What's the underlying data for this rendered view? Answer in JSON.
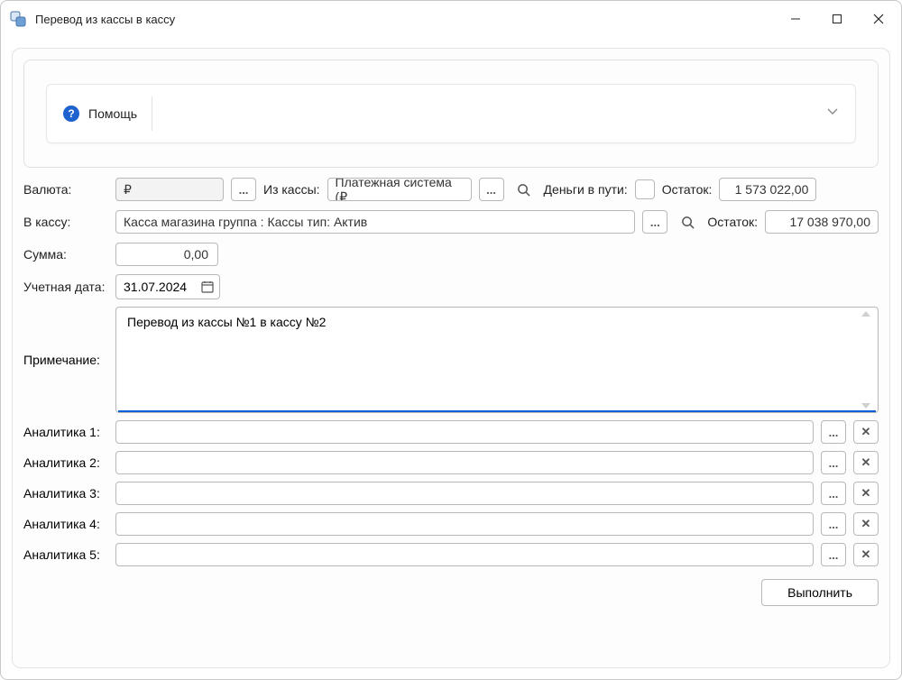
{
  "window": {
    "title": "Перевод из кассы в кассу"
  },
  "help": {
    "label": "Помощь"
  },
  "labels": {
    "currency": "Валюта:",
    "from_cash": "Из кассы:",
    "in_transit": "Деньги в пути:",
    "balance": "Остаток:",
    "to_cash": "В кассу:",
    "balance2": "Остаток:",
    "sum": "Сумма:",
    "accounting_date": "Учетная дата:",
    "note": "Примечание:",
    "analytics1": "Аналитика 1:",
    "analytics2": "Аналитика 2:",
    "analytics3": "Аналитика 3:",
    "analytics4": "Аналитика 4:",
    "analytics5": "Аналитика 5:"
  },
  "values": {
    "currency": "₽",
    "from_cash": "Платежная система (₽",
    "balance_from": "1 573 022,00",
    "to_cash": "Касса магазина  группа : Кассы тип: Актив",
    "balance_to": "17 038 970,00",
    "sum": "0,00",
    "accounting_date": "31.07.2024",
    "note": "Перевод из кассы №1 в кассу №2",
    "an1": "",
    "an2": "",
    "an3": "",
    "an4": "",
    "an5": ""
  },
  "buttons": {
    "ellipsis": "...",
    "clear": "✕",
    "execute": "Выполнить"
  }
}
